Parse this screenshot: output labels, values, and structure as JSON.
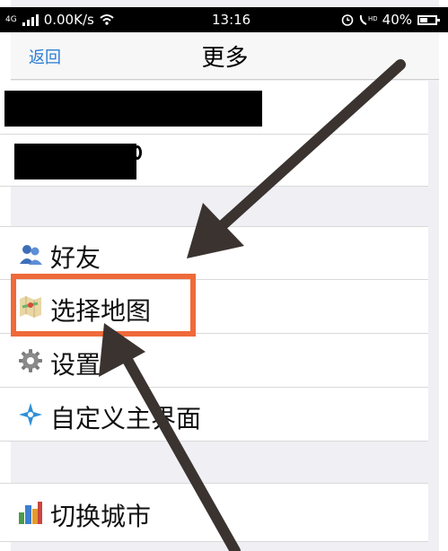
{
  "status_bar": {
    "network": "4G",
    "speed": "0.00K/s",
    "time": "13:16",
    "battery": "40%",
    "icons": [
      "signal-icon",
      "wifi-icon",
      "alarm-icon",
      "hd-call-icon",
      "battery-icon"
    ]
  },
  "nav": {
    "back_label": "返回",
    "title": "更多"
  },
  "menu": {
    "friends": "好友",
    "choose_map": "选择地图",
    "settings": "设置",
    "custom_ui": "自定义主界面",
    "switch_city": "切换城市"
  },
  "colors": {
    "highlight": "#ef6a3a",
    "arrow": "#3a3330",
    "link": "#2b7cd3"
  }
}
